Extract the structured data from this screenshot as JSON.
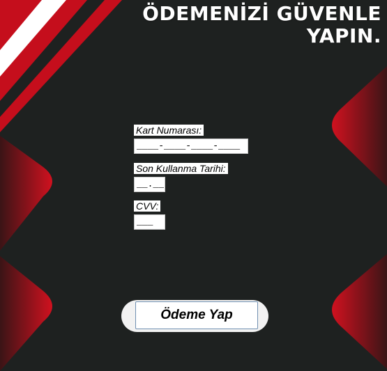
{
  "header": {
    "title_line1": "ÖDEMENİZİ GÜVENLE",
    "title_line2": "YAPIN."
  },
  "form": {
    "card_number": {
      "label": "Kart Numarası:",
      "value": "____-____-____-____"
    },
    "expiry": {
      "label": "Son Kullanma Tarihi:",
      "value": "__.__"
    },
    "cvv": {
      "label": "CVV:",
      "value": "___"
    }
  },
  "actions": {
    "pay_label": "Ödeme Yap"
  },
  "colors": {
    "background": "#1e2120",
    "accent_red": "#c01020",
    "accent_white": "#ffffff"
  }
}
